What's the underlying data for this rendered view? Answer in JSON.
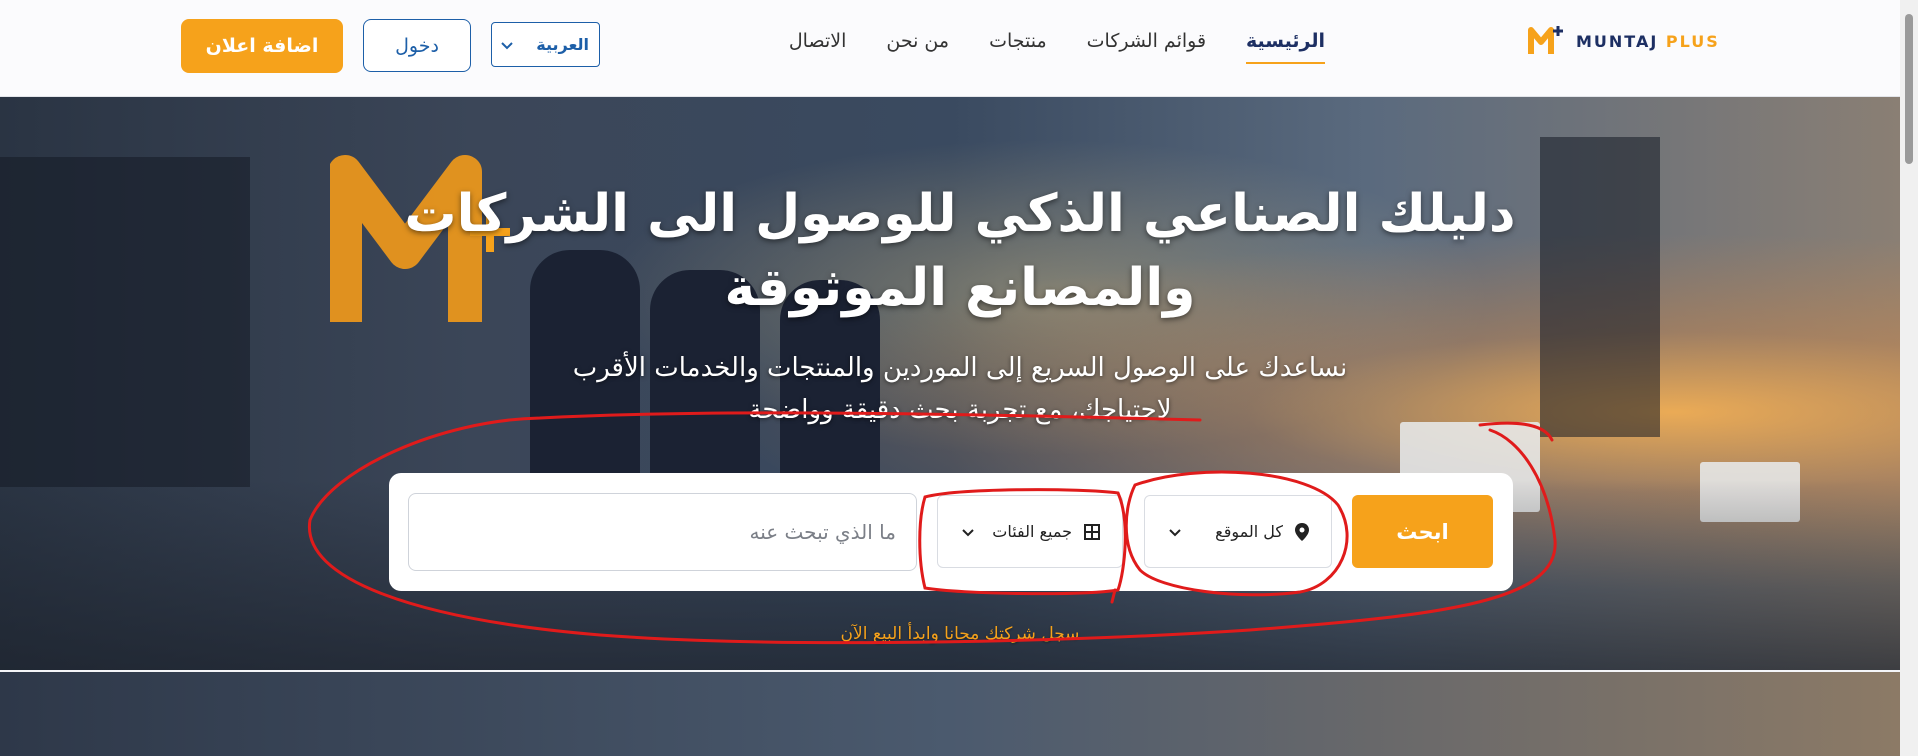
{
  "header": {
    "brand": {
      "name": "MUNTAJ",
      "plus": "PLUS"
    },
    "nav": [
      {
        "label": "الرئيسية",
        "active": true
      },
      {
        "label": "قوائم الشركات",
        "active": false
      },
      {
        "label": "منتجات",
        "active": false
      },
      {
        "label": "من نحن",
        "active": false
      },
      {
        "label": "الاتصال",
        "active": false
      }
    ],
    "language_select": {
      "value": "العربية",
      "icon": "chevron-down-icon"
    },
    "login_label": "دخول",
    "add_ad_label": "اضافة اعلان"
  },
  "hero": {
    "title_line1": "دليلك الصناعي الذكي للوصول الى الشركات",
    "title_line2": "والمصانع الموثوقة",
    "subtitle_line1": "نساعدك على الوصول السريع إلى الموردين والمنتجات والخدمات الأقرب",
    "subtitle_line2": "لاحتياجك، مع تجربة بحث دقيقة وواضحة"
  },
  "search": {
    "button_label": "ابحث",
    "location": {
      "value": "كل الموقع",
      "icon": "map-pin-icon"
    },
    "category": {
      "value": "جميع الفئات",
      "icon": "grid-icon"
    },
    "input": {
      "placeholder": "ما الذي تبحث عنه",
      "value": ""
    }
  },
  "register_link": "سجل شركتك مجانا وابدأ البيع الآن",
  "colors": {
    "accent": "#f6a21b",
    "brand_blue": "#1d5fa8",
    "navy": "#1d2f63",
    "annotation": "#e01b1b"
  }
}
